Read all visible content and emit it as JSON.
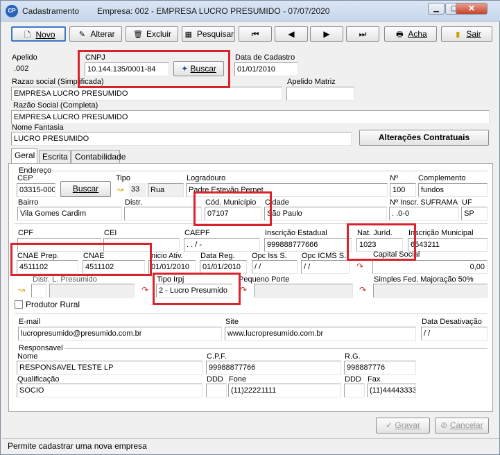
{
  "window": {
    "title": "Cadastramento",
    "company": "Empresa: 002 - EMPRESA LUCRO PRESUMIDO - 07/07/2020",
    "icon": "app-cp-icon",
    "controls": [
      "minimize",
      "maximize",
      "close"
    ]
  },
  "toolbar": {
    "novo": "Novo",
    "alterar": "Alterar",
    "excluir": "Excluir",
    "pesquisar": "Pesquisar",
    "first": "⏮",
    "prev": "◀",
    "next": "▶",
    "last": "⏭",
    "acha": "Acha",
    "sair": "Sair"
  },
  "header": {
    "apelido_label": "Apelido",
    "apelido": ".002",
    "cnpj_label": "CNPJ",
    "cnpj": "10.144.135/0001-84",
    "buscar": "Buscar",
    "data_cadastro_label": "Data de Cadastro",
    "data_cadastro": "01/01/2010",
    "razao_simpl_label": "Razao social (Simplificada)",
    "razao_simpl": "EMPRESA LUCRO PRESUMIDO",
    "apelido_matriz_label": "Apelido Matriz",
    "apelido_matriz": "",
    "razao_compl_label": "Razão Social (Completa)",
    "razao_compl": "EMPRESA LUCRO PRESUMIDO",
    "fantasia_label": "Nome Fantasia",
    "fantasia": "LUCRO PRESUMIDO",
    "alteracoes": "Alterações Contratuais"
  },
  "tabs": [
    "Geral",
    "Escrita",
    "Contabilidade"
  ],
  "endereco": {
    "group": "Endereço",
    "cep_label": "CEP",
    "cep": "03315-000",
    "buscar": "Buscar",
    "tipo_label": "Tipo",
    "tipo_code": "33",
    "tipo": "Rua",
    "logradouro_label": "Logradouro",
    "logradouro": "Padre Estevão Pernet",
    "numero_label": "Nº",
    "numero": "100",
    "complemento_label": "Complemento",
    "complemento": "fundos",
    "bairro_label": "Bairro",
    "bairro": "Vila Gomes Cardim",
    "distr_label": "Distr.",
    "distr": "",
    "cod_mun_label": "Cód. Município",
    "cod_mun": "07107",
    "cidade_label": "Cidade",
    "cidade": "São Paulo",
    "suframa_label": "Nº Inscr. SUFRAMA",
    "suframa": ".   .0-0",
    "uf_label": "UF",
    "uf": "SP"
  },
  "fiscal": {
    "cpf_label": "CPF",
    "cpf": "",
    "cei_label": "CEI",
    "cei": "",
    "caepf_label": "CAEPF",
    "caepf": ".   .   /   -",
    "ie_label": "Inscrição Estadual",
    "ie": "999888777666",
    "nat_label": "Nat. Juríd.",
    "nat": "1023",
    "im_label": "Inscrição Municipal",
    "im": "6543211",
    "cnae_prep_label": "CNAE Prep.",
    "cnae_prep": "4511102",
    "cnae_label": "CNAE",
    "cnae": "4511102",
    "inicio_label": "Inicio Ativ.",
    "inicio": "01/01/2010",
    "data_reg_label": "Data Reg.",
    "data_reg": "01/01/2010",
    "opc_iss_label": "Opc Iss S.",
    "opc_iss": "/   /",
    "opc_icms_label": "Opc ICMS S.",
    "opc_icms": "/   /",
    "capital_label": "Capital Social",
    "capital": "0,00",
    "distr_presumido_label": "Distr. L. Presumido",
    "distr_presumido": "",
    "tipo_irpj_label": "Tipo Irpj",
    "tipo_irpj": "2 - Lucro Presumido",
    "pequeno_porte_label": "Pequeno Porte",
    "pequeno_porte": "",
    "simples_label": "Simples Fed. Majoração 50%",
    "simples": "",
    "produtor_rural": "Produtor Rural"
  },
  "contato": {
    "email_label": "E-mail",
    "email": "lucropresumido@presumido.com.br",
    "site_label": "Site",
    "site": "www.lucropresumido.com.br",
    "desativacao_label": "Data Desativação",
    "desativacao": "/   /"
  },
  "responsavel": {
    "group": "Responsavel",
    "nome_label": "Nome",
    "nome": "RESPONSAVEL TESTE LP",
    "cpf_label": "C.P.F.",
    "cpf": "99988877766",
    "rg_label": "R.G.",
    "rg": "998887776",
    "qualif_label": "Qualificação",
    "qualif": "SOCIO",
    "ddd_label": "DDD",
    "ddd": "",
    "fone_label": "Fone",
    "fone": "(11)22221111",
    "ddd2_label": "DDD",
    "ddd2": "",
    "fax_label": "Fax",
    "fax": "(11)44443333"
  },
  "footer": {
    "gravar": "Gravar",
    "cancelar": "Cancelar",
    "status": "Permite cadastrar uma nova empresa"
  },
  "colors": {
    "highlight": "#d9232d",
    "titlebar": "#c5d6ec"
  }
}
